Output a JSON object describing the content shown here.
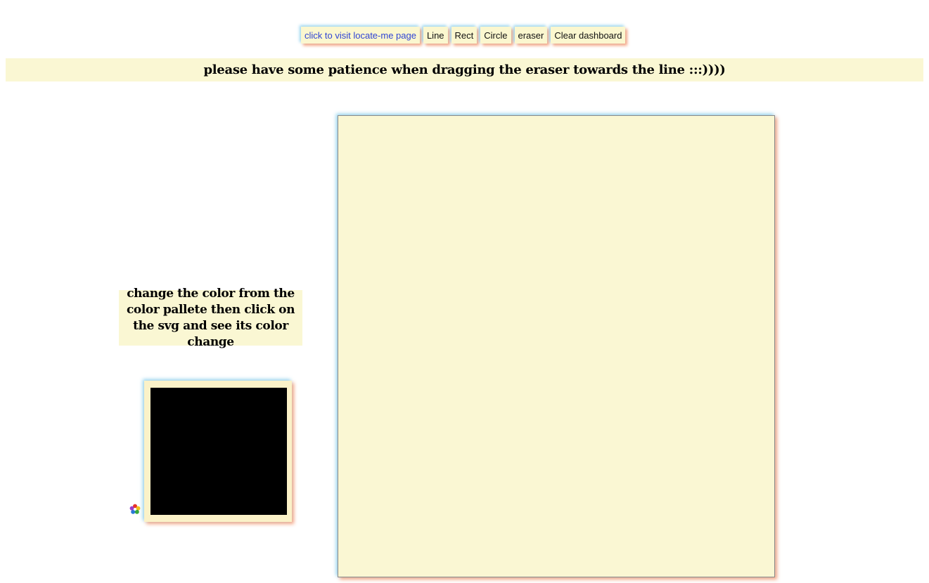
{
  "toolbar": {
    "buttons": [
      {
        "label": "click to visit locate-me page",
        "kind": "link"
      },
      {
        "label": "Line"
      },
      {
        "label": "Rect"
      },
      {
        "label": "Circle"
      },
      {
        "label": "eraser"
      },
      {
        "label": "Clear dashboard"
      }
    ]
  },
  "banner": {
    "text": "please have some patience when dragging the eraser towards the line :::))))"
  },
  "instructions": {
    "text": "change the color from the color pallete then click on the svg and see its color change"
  },
  "palette": {
    "icon": "color-palette-icon"
  },
  "swatch": {
    "fill_color": "#000000"
  },
  "colors": {
    "panel_background": "#faf7d3",
    "link": "#2f44d4",
    "shadow_blue": "#78c8eb",
    "shadow_orange": "#f5966e"
  }
}
